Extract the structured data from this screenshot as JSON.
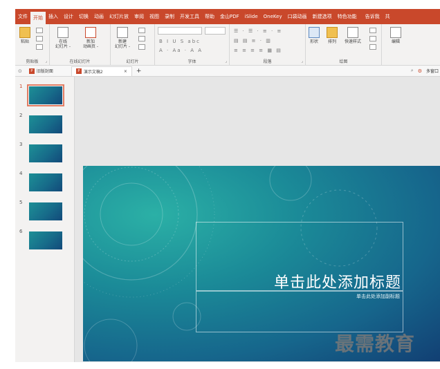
{
  "ribbon_tabs": [
    "文件",
    "开始",
    "插入",
    "设计",
    "切换",
    "动画",
    "幻灯片放",
    "审阅",
    "视图",
    "录制",
    "开发工具",
    "帮助",
    "金山PDF",
    "iSlide",
    "OneKey",
    "口袋动画",
    "新建选项",
    "特色功能",
    "告诉我",
    "共"
  ],
  "active_tab_index": 1,
  "groups": {
    "clipboard": {
      "label": "剪贴板",
      "paste": "粘贴"
    },
    "online_slides": {
      "label": "在线幻灯片",
      "online": "在线\n幻灯片 -",
      "new_anim": "新加\n动画页 -"
    },
    "slides": {
      "label": "幻灯片",
      "new_slide": "新建\n幻灯片 -"
    },
    "font": {
      "label": "字体",
      "bold": "B",
      "italic": "I",
      "underline": "U",
      "strike": "S",
      "abc": "abc"
    },
    "paragraph": {
      "label": "段落"
    },
    "drawing": {
      "label": "绘图",
      "shape": "形状",
      "arrange": "排列",
      "quick_style": "快速样式"
    },
    "editing": {
      "label": "编辑"
    }
  },
  "document_tabs": [
    {
      "label": "旧版封面",
      "active": false
    },
    {
      "label": "演示文稿2",
      "active": true
    }
  ],
  "new_tab_symbol": "+",
  "right_tool": "多窗口",
  "slides": [
    {
      "number": "1",
      "selected": true
    },
    {
      "number": "2",
      "selected": false
    },
    {
      "number": "3",
      "selected": false
    },
    {
      "number": "4",
      "selected": false
    },
    {
      "number": "5",
      "selected": false
    },
    {
      "number": "6",
      "selected": false
    }
  ],
  "slide": {
    "title_placeholder": "单击此处添加标题",
    "subtitle_placeholder": "单击此处添加副标题"
  },
  "watermark": "最需教育",
  "colors": {
    "accent": "#c9482b",
    "slide_dark": "#123f73",
    "slide_light": "#2bb0a6"
  }
}
